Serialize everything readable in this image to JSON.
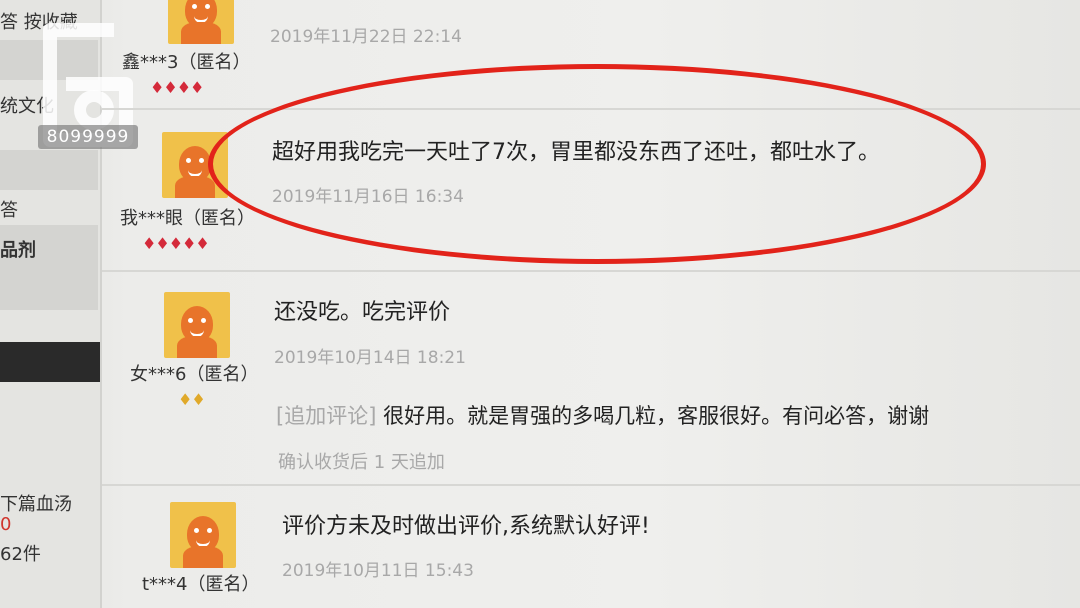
{
  "sidebar": {
    "texts": [
      "答 按收藏",
      "统文化",
      "答",
      "品剂",
      "下篇血汤",
      "0",
      "62件"
    ]
  },
  "watermark": {
    "logo_digit": "6",
    "number": "8099999"
  },
  "reviews": [
    {
      "user": "鑫***3（匿名）",
      "rank": "♦♦♦♦",
      "rank_color": "red",
      "content": "",
      "date": "2019年11月22日  22:14"
    },
    {
      "user": "我***眼（匿名）",
      "rank": "♦♦♦♦♦",
      "rank_color": "red",
      "content": "超好用我吃完一天吐了7次，胃里都没东西了还吐，都吐水了。",
      "date": "2019年11月16日  16:34",
      "highlighted": true
    },
    {
      "user": "女***6（匿名）",
      "rank": "♦♦",
      "rank_color": "gold",
      "content": "还没吃。吃完评价",
      "date": "2019年10月14日  18:21",
      "append_tag": "[追加评论]",
      "append_content": " 很好用。就是胃强的多喝几粒，客服很好。有问必答，谢谢",
      "append_note": "确认收货后 1 天追加"
    },
    {
      "user": "t***4（匿名）",
      "rank": "",
      "rank_color": "gold",
      "content": "评价方未及时做出评价,系统默认好评!",
      "date": "2019年10月11日  15:43"
    }
  ],
  "colors": {
    "highlight": "#e2231a",
    "rank_red": "#d42a3a",
    "rank_gold": "#e0a92a",
    "date_gray": "#a8a8a8"
  }
}
